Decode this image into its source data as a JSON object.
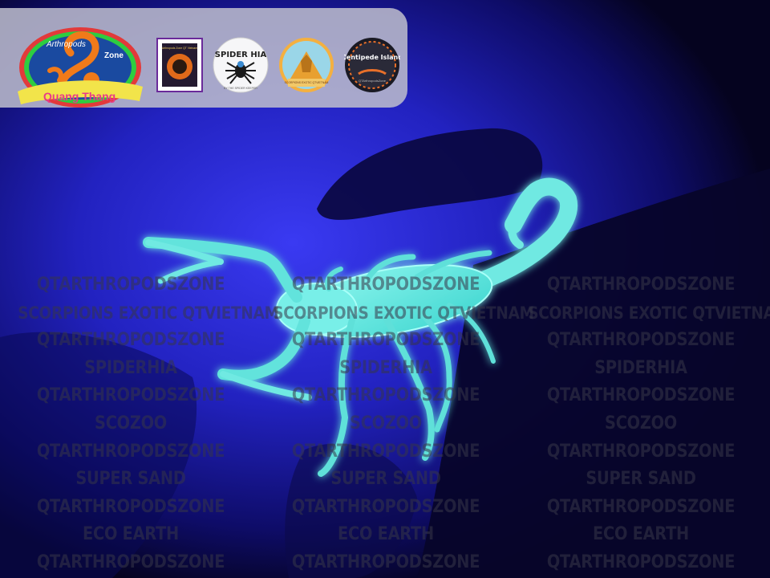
{
  "logos": {
    "main": {
      "top_text": "Arthropods",
      "right_text": "Zone",
      "bottom_text": "Quang Thang"
    },
    "square_badge": {
      "text": "Arthropods Zone QT Vietnam"
    },
    "spider": {
      "title": "SPIDER HIA",
      "sub": "BY THE SPIDER KEEPER"
    },
    "pyramid": {
      "text": "SCORPIONS EXOTIC QTVIETNAM"
    },
    "centipede": {
      "title": "Centipede Island",
      "sub": "QTArthropodsZone"
    }
  },
  "watermark": {
    "columns": [
      {
        "lines": [
          "QTARTHROPODSZONE",
          "SCORPIONS EXOTIC QTVIETNAM",
          "QTARTHROPODSZONE",
          "SPIDERHIA",
          "QTARTHROPODSZONE",
          "SCOZOO",
          "QTARTHROPODSZONE",
          "SUPER SAND",
          "QTARTHROPODSZONE",
          "ECO EARTH",
          "QTARTHROPODSZONE"
        ]
      },
      {
        "lines": [
          "QTARTHROPODSZONE",
          "SCORPIONS EXOTIC QTVIETNAM",
          "QTARTHROPODSZONE",
          "SPIDERHIA",
          "QTARTHROPODSZONE",
          "SCOZOO",
          "QTARTHROPODSZONE",
          "SUPER SAND",
          "QTARTHROPODSZONE",
          "ECO EARTH",
          "QTARTHROPODSZONE"
        ]
      },
      {
        "lines": [
          "QTARTHROPODSZONE",
          "SCORPIONS EXOTIC QTVIETNAM",
          "QTARTHROPODSZONE",
          "SPIDERHIA",
          "QTARTHROPODSZONE",
          "SCOZOO",
          "QTARTHROPODSZONE",
          "SUPER SAND",
          "QTARTHROPODSZONE",
          "ECO EARTH",
          "QTARTHROPODSZONE"
        ]
      }
    ]
  },
  "colors": {
    "uv_glow": "#58e8e0",
    "background": "#1a1aa8",
    "logo_orange": "#e8701a"
  }
}
